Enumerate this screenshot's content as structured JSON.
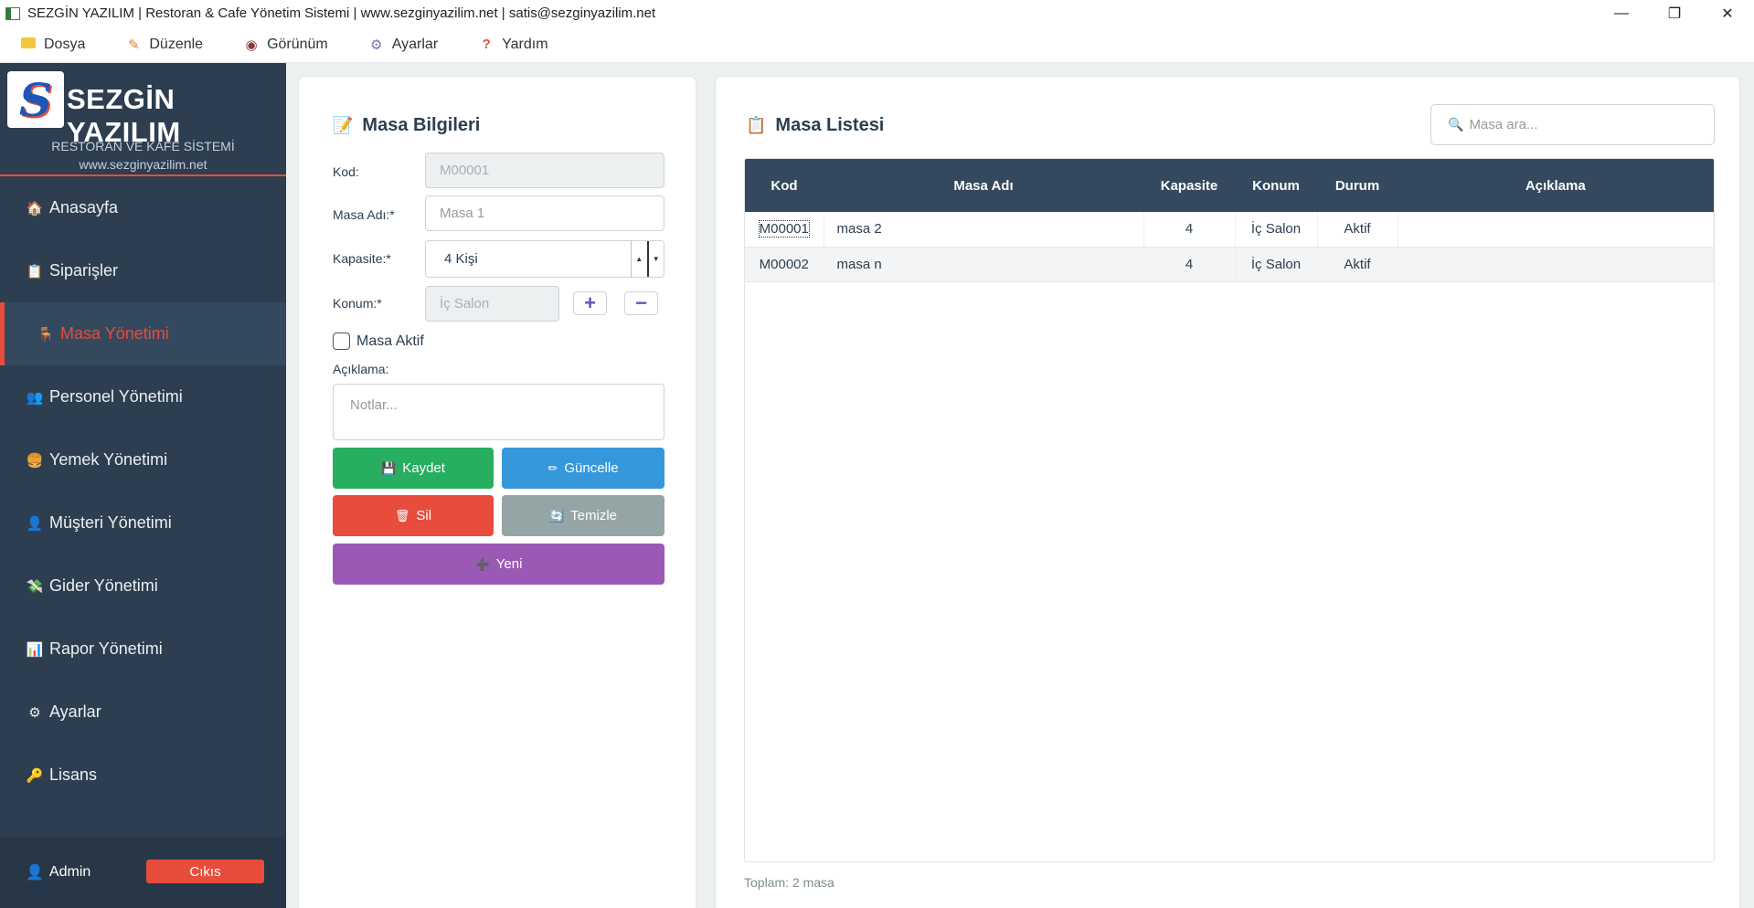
{
  "window": {
    "title": "SEZGİN YAZILIM | Restoran & Cafe Yönetim Sistemi | www.sezginyazilim.net | satis@sezginyazilim.net",
    "minimize": "—",
    "maximize": "❐",
    "close": "✕"
  },
  "menubar": {
    "items": [
      {
        "label": "Dosya",
        "icon": "folder-icon"
      },
      {
        "label": "Düzenle",
        "icon": "pencil-icon"
      },
      {
        "label": "Görünüm",
        "icon": "eye-icon"
      },
      {
        "label": "Ayarlar",
        "icon": "gear-icon"
      },
      {
        "label": "Yardım",
        "icon": "question-icon"
      }
    ]
  },
  "sidebar": {
    "brand": "SEZGİN YAZILIM",
    "logo_letter": "S",
    "subtitle": "RESTORAN VE KAFE SİSTEMİ",
    "website": "www.sezginyazilim.net",
    "items": [
      {
        "label": "Anasayfa",
        "icon": "🏠"
      },
      {
        "label": "Siparişler",
        "icon": "📋"
      },
      {
        "label": "Masa Yönetimi",
        "icon": "🪑"
      },
      {
        "label": "Personel Yönetimi",
        "icon": "👥"
      },
      {
        "label": "Yemek Yönetimi",
        "icon": "🍔"
      },
      {
        "label": "Müşteri Yönetimi",
        "icon": "👤"
      },
      {
        "label": "Gider Yönetimi",
        "icon": "💸"
      },
      {
        "label": "Rapor Yönetimi",
        "icon": "📊"
      },
      {
        "label": "Ayarlar",
        "icon": "⚙"
      },
      {
        "label": "Lisans",
        "icon": "🔑"
      }
    ],
    "active_index": 2,
    "user": "Admin",
    "logout": "Cıkıs"
  },
  "form": {
    "title": "Masa Bilgileri",
    "code_label": "Kod:",
    "code_placeholder": "M00001",
    "name_label": "Masa Adı:*",
    "name_placeholder": "Masa 1",
    "capacity_label": "Kapasite:*",
    "capacity_value": "4 Kişi",
    "location_label": "Konum:*",
    "location_value": "İç Salon",
    "active_label": "Masa Aktif",
    "active_checked": false,
    "notes_label": "Açıklama:",
    "notes_placeholder": "Notlar...",
    "buttons": {
      "save": "Kaydet",
      "update": "Güncelle",
      "delete": "Sil",
      "clear": "Temizle",
      "new": "Yeni"
    },
    "colors": {
      "save": "#27ae60",
      "update": "#3498db",
      "delete": "#e74c3c",
      "clear": "#95a5a6",
      "new": "#9b59b6"
    }
  },
  "list": {
    "title": "Masa Listesi",
    "search_placeholder": "Masa ara...",
    "columns": [
      "Kod",
      "Masa Adı",
      "Kapasite",
      "Konum",
      "Durum",
      "Açıklama"
    ],
    "rows": [
      [
        "M00001",
        "masa 2",
        "4",
        "İç Salon",
        "Aktif",
        ""
      ],
      [
        "M00002",
        "masa n",
        "4",
        "İç Salon",
        "Aktif",
        ""
      ]
    ],
    "total": "Toplam: 2 masa"
  },
  "colors": {
    "sidebar_bg": "#2c3e50",
    "accent": "#e74c3c",
    "table_header": "#34495e"
  }
}
